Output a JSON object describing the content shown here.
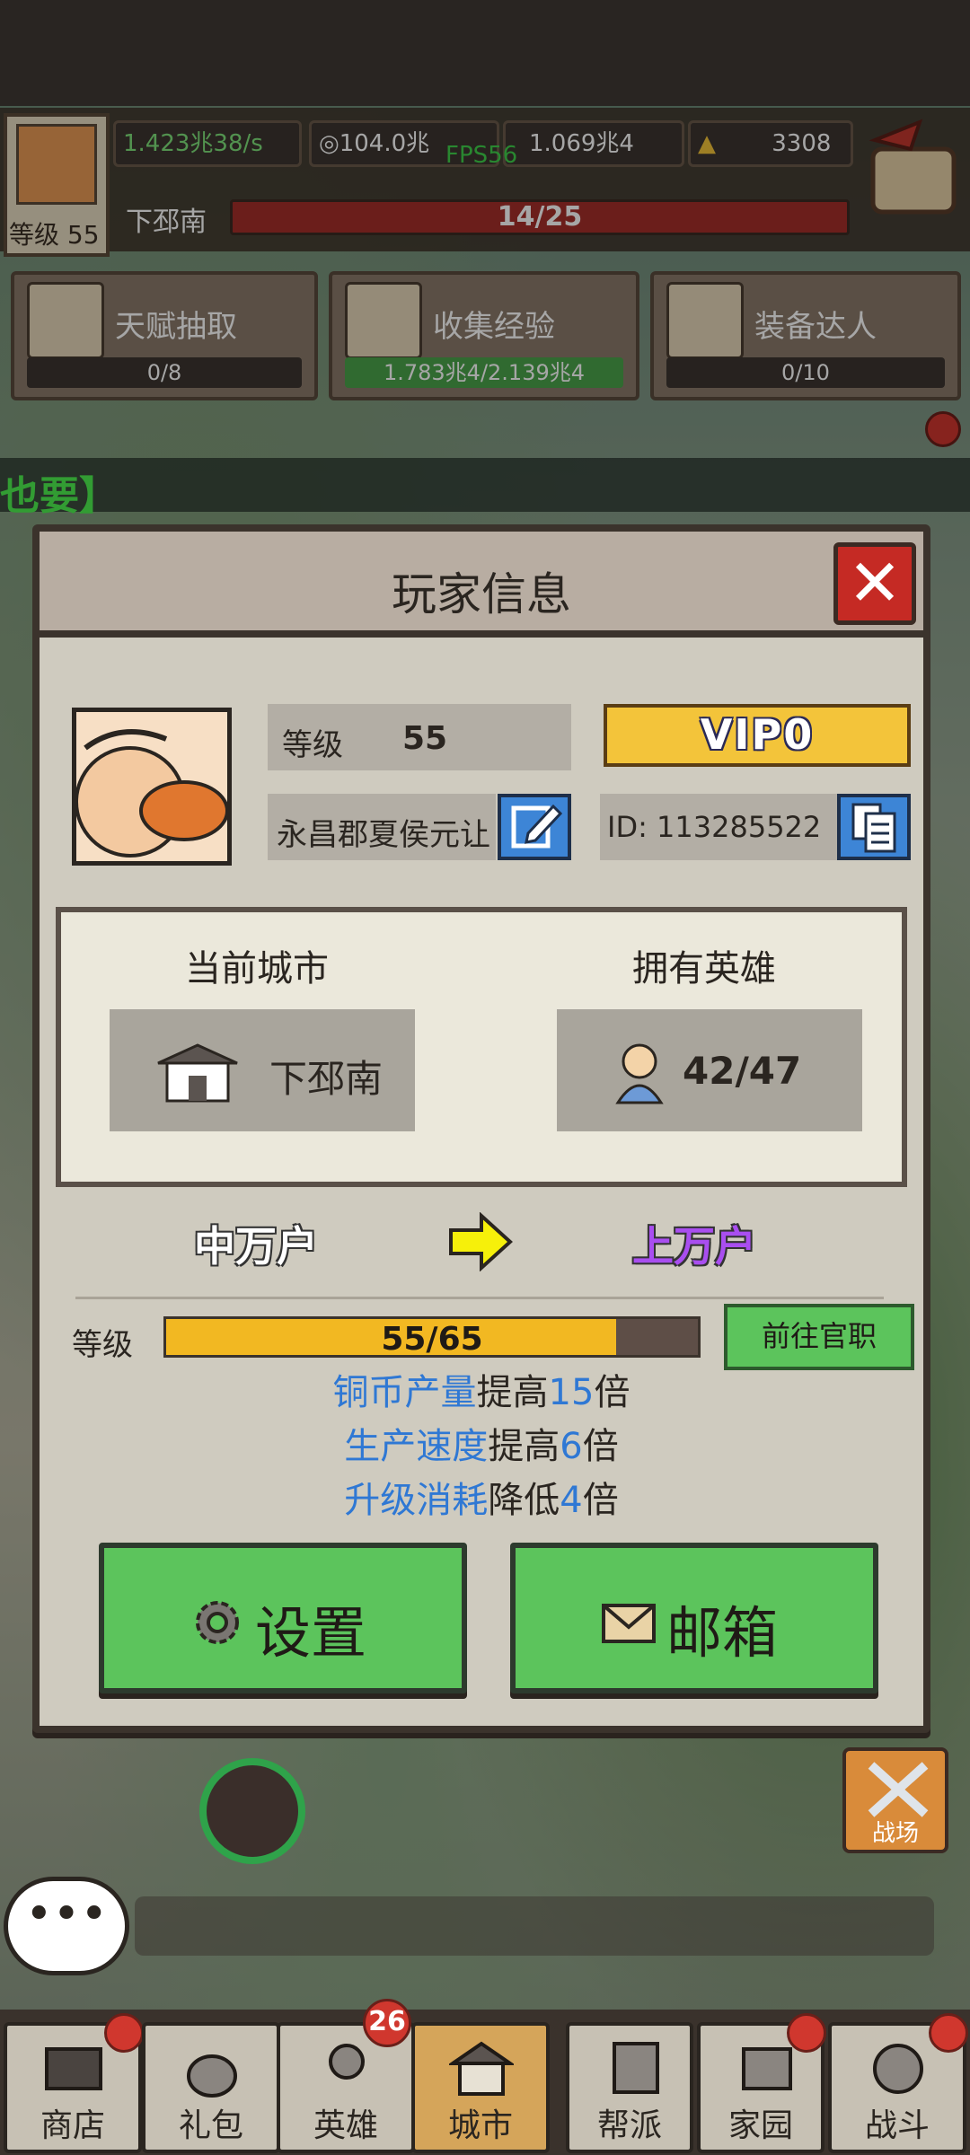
{
  "hud": {
    "level_label": "等级",
    "level_value": "55",
    "income_rate": "1.423兆38/s",
    "copper": "104.0兆",
    "fps": "FPS56",
    "exp": "1.069兆4",
    "gold": "3308",
    "city_name": "下邳南",
    "city_progress": "14/25"
  },
  "tasks": [
    {
      "title": "天赋抽取",
      "progress": "0/8"
    },
    {
      "title": "收集经验",
      "progress": "1.783兆4/2.139兆4"
    },
    {
      "title": "装备达人",
      "progress": "0/10"
    }
  ],
  "banner_text": "也要】",
  "modal": {
    "title": "玩家信息",
    "close_icon": "close-icon",
    "level_label": "等级",
    "level_value": "55",
    "vip": "VIP0",
    "player_name": "永昌郡夏侯元让",
    "id_text": "ID:  113285522",
    "current_city_label": "当前城市",
    "current_city_value": "下邳南",
    "heroes_label": "拥有英雄",
    "heroes_value": "42/47",
    "rank_from": "中万户",
    "rank_to": "上万户",
    "rank_level_label": "等级",
    "rank_level_progress": "55/65",
    "rank_level_fraction": 0.846,
    "goto_button": "前往官职",
    "bonuses": [
      {
        "name": "铜币产量",
        "verb": "提高",
        "value": "15",
        "unit": "倍"
      },
      {
        "name": "生产速度",
        "verb": "提高",
        "value": "6",
        "unit": "倍"
      },
      {
        "name": "升级消耗",
        "verb": "降低",
        "value": "4",
        "unit": "倍"
      }
    ],
    "settings_button": "设置",
    "mail_button": "邮箱"
  },
  "bottom": {
    "chat_icon": "•••",
    "battle_label": "战场",
    "hero_badge": "26"
  },
  "nav": [
    {
      "label": "商店"
    },
    {
      "label": "礼包"
    },
    {
      "label": "英雄"
    },
    {
      "label": "城市"
    },
    {
      "label": "帮派"
    },
    {
      "label": "家园"
    },
    {
      "label": "战斗"
    }
  ],
  "colors": {
    "accent_green": "#5cc45c",
    "progress_yellow": "#f2b822",
    "highlight_blue": "#2f78d4",
    "rank_purple": "#a94ef0",
    "close_red": "#c52a24"
  }
}
